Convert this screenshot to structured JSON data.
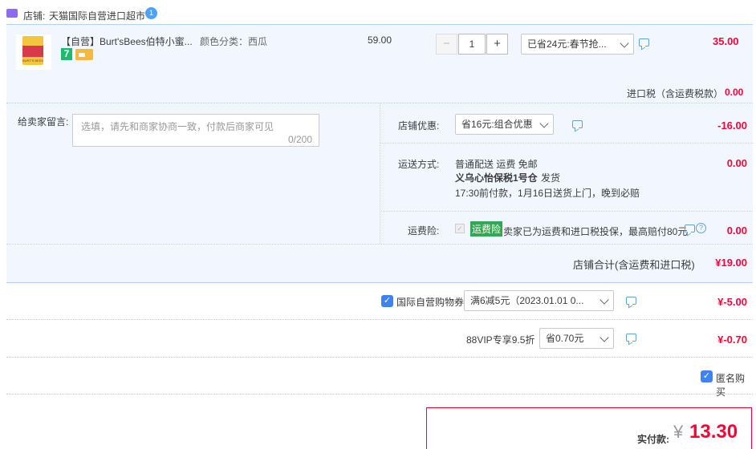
{
  "shop": {
    "prefix": "店铺:",
    "name": "天猫国际自营进口超市"
  },
  "item": {
    "title": "【自营】Burt'sBees伯特小蜜...",
    "spec": "颜色分类：西瓜",
    "unit_price": "59.00",
    "quantity": "1",
    "minus": "−",
    "plus": "+",
    "promo_select": "已省24元:春节抢...",
    "subtotal": "35.00",
    "badge_7": "7",
    "tax_label": "进口税（含运费税款）",
    "tax_value": "0.00",
    "thumb_label": "BURT'S BEES"
  },
  "message": {
    "label": "给卖家留言:",
    "placeholder": "选填，请先和商家协商一致，付款后商家可见",
    "counter": "0/200"
  },
  "shop_discount": {
    "label": "店铺优惠:",
    "select": "省16元:组合优惠",
    "value": "-16.00"
  },
  "shipping": {
    "label": "运送方式:",
    "line1": "普通配送 运费 免邮",
    "line2": "义乌心怡保税1号仓",
    "line2b": "发货",
    "line3": "17:30前付款，1月16日送货上门，晚到必赔",
    "value": "0.00"
  },
  "insurance": {
    "label": "运费险:",
    "tag": "运费险",
    "text": "卖家已为运费和进口税投保，最高赔付80元",
    "value": "0.00"
  },
  "shop_total": {
    "label": "店铺合计(含运费和进口税)",
    "value": "¥19.00"
  },
  "coupon": {
    "label": "国际自营购物券",
    "select": "满6减5元（2023.01.01 0...",
    "value": "¥-5.00"
  },
  "vip": {
    "label": "88VIP专享9.5折",
    "select": "省0.70元",
    "value": "¥-0.70"
  },
  "anonymous": {
    "label": "匿名购买"
  },
  "payment": {
    "label": "实付款:",
    "currency": "¥",
    "value": "13.30"
  },
  "colors": {
    "accent_red": "#ff0036",
    "check_blue": "#3e82f7",
    "panel_blue": "#f2f7ff"
  }
}
